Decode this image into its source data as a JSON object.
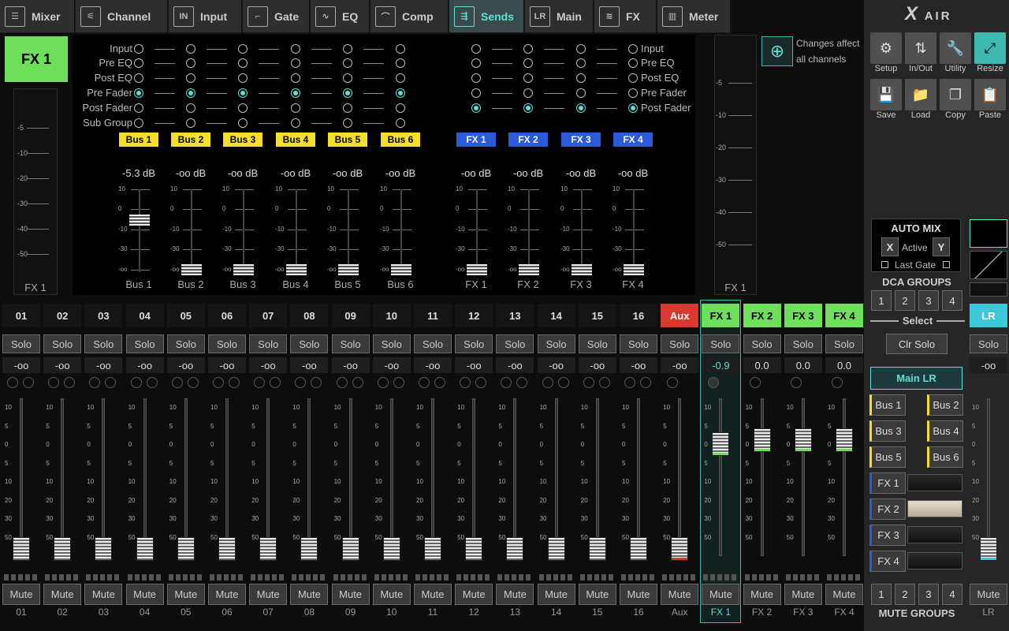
{
  "tabs": [
    {
      "label": "Mixer",
      "icon": "mixer-icon",
      "glyph": "☰"
    },
    {
      "label": "Channel",
      "icon": "channel-icon",
      "glyph": "⚟"
    },
    {
      "label": "Input",
      "icon": "input-icon",
      "glyph": "IN"
    },
    {
      "label": "Gate",
      "icon": "gate-icon",
      "glyph": "⌐"
    },
    {
      "label": "EQ",
      "icon": "eq-icon",
      "glyph": "∿"
    },
    {
      "label": "Comp",
      "icon": "comp-icon",
      "glyph": "⌒"
    },
    {
      "label": "Sends",
      "icon": "sends-icon",
      "glyph": "⇶"
    },
    {
      "label": "Main",
      "icon": "main-icon",
      "glyph": "LR"
    },
    {
      "label": "FX",
      "icon": "fx-icon",
      "glyph": "≋"
    },
    {
      "label": "Meter",
      "icon": "meter-icon",
      "glyph": "▥"
    }
  ],
  "selected_tab": "Sends",
  "logo": {
    "x": "X",
    "air": "AIR"
  },
  "tools": [
    {
      "label": "Setup",
      "glyph": "⚙"
    },
    {
      "label": "In/Out",
      "glyph": "⇅"
    },
    {
      "label": "Utility",
      "glyph": "🔧"
    },
    {
      "label": "Resize",
      "glyph": "⤢"
    },
    {
      "label": "Save",
      "glyph": "💾"
    },
    {
      "label": "Load",
      "glyph": "📁"
    },
    {
      "label": "Copy",
      "glyph": "❐"
    },
    {
      "label": "Paste",
      "glyph": "📋"
    }
  ],
  "sends": {
    "selected_channel": "FX 1",
    "left_meter_label": "FX 1",
    "right_meter_label": "FX 1",
    "changes_note_1": "Changes affect",
    "changes_note_2": "all channels",
    "left_meter_ticks": [
      "-5",
      "-10",
      "-20",
      "-30",
      "-40",
      "-50"
    ],
    "right_meter_ticks": [
      "-5",
      "-10",
      "-20",
      "-30",
      "-40",
      "-50"
    ],
    "tap_options_left": [
      "Input",
      "Pre EQ",
      "Post EQ",
      "Pre Fader",
      "Post Fader",
      "Sub Group"
    ],
    "tap_options_right": [
      "Input",
      "Pre EQ",
      "Post EQ",
      "Pre Fader",
      "Post Fader"
    ],
    "fader_ticks": [
      "10",
      "0",
      "-10",
      "-30",
      "-oo"
    ],
    "buses": [
      {
        "name": "Bus 1",
        "db": "-5.3 dB"
      },
      {
        "name": "Bus 2",
        "db": "-oo dB"
      },
      {
        "name": "Bus 3",
        "db": "-oo dB"
      },
      {
        "name": "Bus 4",
        "db": "-oo dB"
      },
      {
        "name": "Bus 5",
        "db": "-oo dB"
      },
      {
        "name": "Bus 6",
        "db": "-oo dB"
      }
    ],
    "fx": [
      {
        "name": "FX 1",
        "db": "-oo dB"
      },
      {
        "name": "FX 2",
        "db": "-oo dB"
      },
      {
        "name": "FX 3",
        "db": "-oo dB"
      },
      {
        "name": "FX 4",
        "db": "-oo dB"
      }
    ]
  },
  "channels": [
    {
      "id": "01",
      "name": "01",
      "val": "-oo"
    },
    {
      "id": "02",
      "name": "02",
      "val": "-oo"
    },
    {
      "id": "03",
      "name": "03",
      "val": "-oo"
    },
    {
      "id": "04",
      "name": "04",
      "val": "-oo"
    },
    {
      "id": "05",
      "name": "05",
      "val": "-oo"
    },
    {
      "id": "06",
      "name": "06",
      "val": "-oo"
    },
    {
      "id": "07",
      "name": "07",
      "val": "-oo"
    },
    {
      "id": "08",
      "name": "08",
      "val": "-oo"
    },
    {
      "id": "09",
      "name": "09",
      "val": "-oo"
    },
    {
      "id": "10",
      "name": "10",
      "val": "-oo"
    },
    {
      "id": "11",
      "name": "11",
      "val": "-oo"
    },
    {
      "id": "12",
      "name": "12",
      "val": "-oo"
    },
    {
      "id": "13",
      "name": "13",
      "val": "-oo"
    },
    {
      "id": "14",
      "name": "14",
      "val": "-oo"
    },
    {
      "id": "15",
      "name": "15",
      "val": "-oo"
    },
    {
      "id": "16",
      "name": "16",
      "val": "-oo"
    },
    {
      "id": "Aux",
      "name": "Aux",
      "val": "-oo"
    },
    {
      "id": "FX 1",
      "name": "FX 1",
      "val": "-0.9"
    },
    {
      "id": "FX 2",
      "name": "FX 2",
      "val": "0.0"
    },
    {
      "id": "FX 3",
      "name": "FX 3",
      "val": "0.0"
    },
    {
      "id": "FX 4",
      "name": "FX 4",
      "val": "0.0"
    }
  ],
  "solo_label": "Solo",
  "mute_label": "Mute",
  "strip_scale": [
    "10",
    "5",
    "0",
    "5",
    "10",
    "20",
    "30",
    "50"
  ],
  "lr": {
    "label": "LR",
    "val": "-oo",
    "name": "LR"
  },
  "automix": {
    "title": "AUTO MIX",
    "x": "X",
    "active": "Active",
    "y": "Y",
    "last_gate": "Last Gate"
  },
  "dca": {
    "title": "DCA GROUPS",
    "buttons": [
      "1",
      "2",
      "3",
      "4"
    ],
    "select": "Select",
    "clr_solo": "Clr Solo"
  },
  "main_lr": "Main LR",
  "bus_buttons": [
    "Bus 1",
    "Bus 2",
    "Bus 3",
    "Bus 4",
    "Bus 5",
    "Bus 6"
  ],
  "fx_buttons": [
    "FX 1",
    "FX 2",
    "FX 3",
    "FX 4"
  ],
  "mute_groups": {
    "title": "MUTE GROUPS",
    "buttons": [
      "1",
      "2",
      "3",
      "4"
    ]
  },
  "colors": {
    "accent": "#5fe0d5",
    "fx_green": "#6ddf5a",
    "bus_yellow": "#f4e02a",
    "fx_blue": "#2a5ad8",
    "aux_red": "#d83a30",
    "lr_cyan": "#3cc8d8"
  }
}
